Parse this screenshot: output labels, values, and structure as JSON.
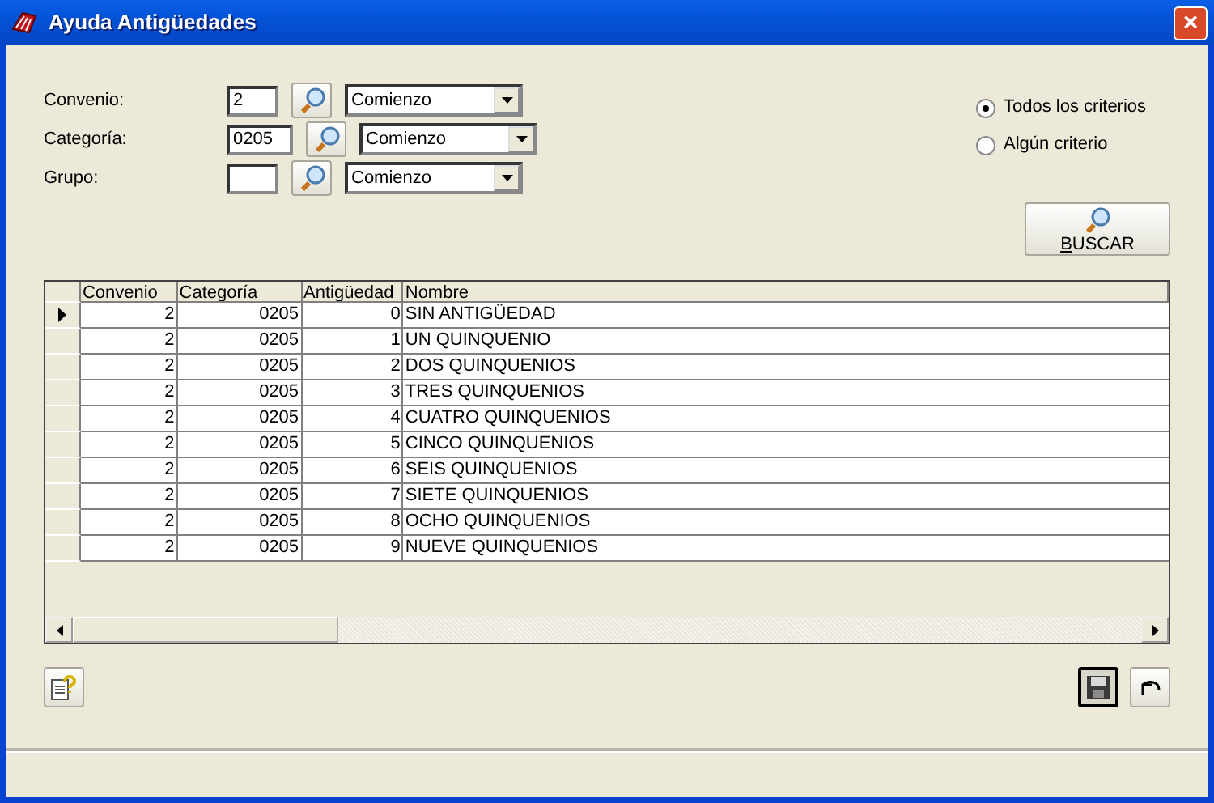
{
  "window": {
    "title": "Ayuda Antigüedades",
    "close": "×"
  },
  "filters": [
    {
      "label": "Convenio:",
      "value": "2",
      "mode": "Comienzo",
      "wide": false
    },
    {
      "label": "Categoría:",
      "value": "0205",
      "mode": "Comienzo",
      "wide": true
    },
    {
      "label": "Grupo:",
      "mode": "Comienzo",
      "wide": false
    }
  ],
  "criteria": [
    {
      "label": "Todos los criterios",
      "selected": true
    },
    {
      "label": "Algún criterio",
      "selected": false
    }
  ],
  "search_button": {
    "label": "BUSCAR"
  },
  "table": {
    "columns": [
      "Convenio",
      "Categoría",
      "Antigüedad",
      "Nombre"
    ],
    "rows": [
      {
        "cells": [
          "2",
          "0205",
          "0",
          "SIN ANTIGÜEDAD"
        ],
        "selected": true
      },
      {
        "cells": [
          "2",
          "0205",
          "1",
          "UN QUINQUENIO"
        ],
        "selected": false
      },
      {
        "cells": [
          "2",
          "0205",
          "2",
          "DOS QUINQUENIOS"
        ],
        "selected": false
      },
      {
        "cells": [
          "2",
          "0205",
          "3",
          "TRES QUINQUENIOS"
        ],
        "selected": false
      },
      {
        "cells": [
          "2",
          "0205",
          "4",
          "CUATRO QUINQUENIOS"
        ],
        "selected": false
      },
      {
        "cells": [
          "2",
          "0205",
          "5",
          "CINCO QUINQUENIOS"
        ],
        "selected": false
      },
      {
        "cells": [
          "2",
          "0205",
          "6",
          "SEIS QUINQUENIOS"
        ],
        "selected": false
      },
      {
        "cells": [
          "2",
          "0205",
          "7",
          "SIETE QUINQUENIOS"
        ],
        "selected": false
      },
      {
        "cells": [
          "2",
          "0205",
          "8",
          "OCHO QUINQUENIOS"
        ],
        "selected": false
      },
      {
        "cells": [
          "2",
          "0205",
          "9",
          "NUEVE QUINQUENIOS"
        ],
        "selected": false
      }
    ]
  },
  "bottom_buttons": [
    {
      "kind": "help",
      "focused": false
    },
    {
      "kind": "save",
      "focused": true
    },
    {
      "kind": "undo",
      "focused": false
    }
  ]
}
